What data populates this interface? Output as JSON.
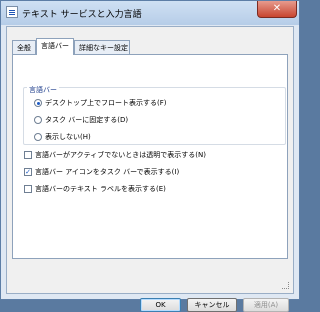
{
  "window": {
    "title": "テキスト サービスと入力言語"
  },
  "tabs": [
    {
      "label": "全般"
    },
    {
      "label": "言語バー"
    },
    {
      "label": "詳細なキー設定"
    }
  ],
  "language_bar": {
    "group_label": "言語バー",
    "options": [
      {
        "label": "デスクトップ上でフロート表示する(F)",
        "selected": true
      },
      {
        "label": "タスク バーに固定する(D)",
        "selected": false
      },
      {
        "label": "表示しない(H)",
        "selected": false
      }
    ]
  },
  "checkboxes": [
    {
      "label": "言語バーがアクティブでないときは透明で表示する(N)",
      "checked": false
    },
    {
      "label": "言語バー アイコンをタスク バーで表示する(I)",
      "checked": true
    },
    {
      "label": "言語バーのテキスト ラベルを表示する(E)",
      "checked": false
    }
  ],
  "buttons": {
    "ok": "OK",
    "cancel": "キャンセル",
    "apply": "適用(A)"
  },
  "icons": {
    "close": "close-icon",
    "window": "keyboard-icon",
    "check": "✓"
  },
  "colors": {
    "accent": "#1d5bc5",
    "window_frame": "#b6cde8",
    "close_red": "#c8452f"
  }
}
